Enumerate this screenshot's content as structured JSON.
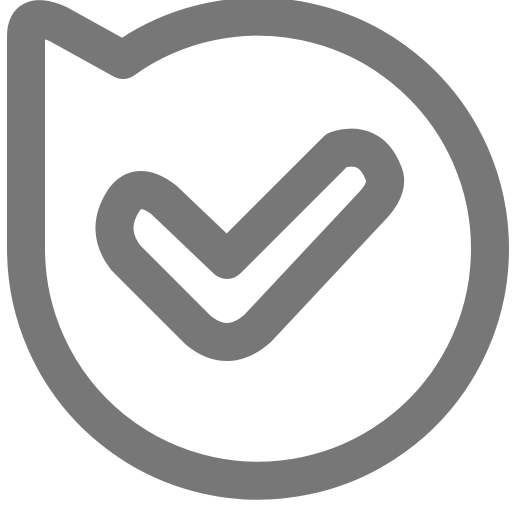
{
  "icon": {
    "name": "check-badge-icon",
    "color": "#777777",
    "background": "#ffffff"
  }
}
